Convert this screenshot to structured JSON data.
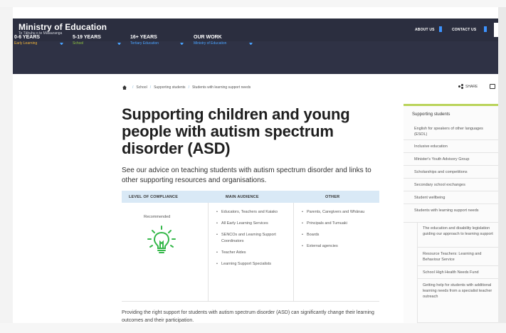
{
  "header": {
    "title": "Ministry of Education",
    "subtitle": "Te Tāhuhu o te Mātauranga",
    "utility_links": [
      {
        "label": "ABOUT US"
      },
      {
        "label": "CONTACT US"
      }
    ],
    "nav": [
      {
        "title": "0-6 YEARS",
        "sub": "Early Learning",
        "sub_color": "#f2b53a"
      },
      {
        "title": "5-19 YEARS",
        "sub": "School",
        "sub_color": "#8fc43f"
      },
      {
        "title": "16+ YEARS",
        "sub": "Tertiary Education",
        "sub_color": "#4aa3ff"
      },
      {
        "title": "OUR WORK",
        "sub": "Ministry of Education",
        "sub_color": "#4aa3ff"
      }
    ]
  },
  "breadcrumb": {
    "items": [
      "School",
      "Supporting students",
      "Students with learning support needs"
    ]
  },
  "share": {
    "label": "SHARE"
  },
  "main": {
    "headline": "Supporting children and young people with autism spectrum disorder (ASD)",
    "intro": "See our advice on teaching students with autism spectrum disorder and links to other supporting resources and organisations.",
    "table": {
      "headers": [
        "LEVEL OF COMPLIANCE",
        "MAIN AUDIENCE",
        "OTHER"
      ],
      "compliance": "Recommended",
      "main_audience": [
        "Educators, Teachers and Kaiako",
        "All Early Learning Services",
        "SENCOs and Learning Support Coordinators",
        "Teacher Aides",
        "Learning Support Specialists"
      ],
      "other": [
        "Parents, Caregivers and Whānau",
        "Principals and Tumuaki",
        "Boards",
        "External agencies"
      ]
    },
    "paragraph": "Providing the right support for students with autism spectrum disorder (ASD) can significantly change their learning outcomes and their participation."
  },
  "sidebar": {
    "title": "Supporting students",
    "items": [
      "English for speakers of other languages (ESOL)",
      "Inclusive education",
      "Minister's Youth Advisory Group",
      "Scholarships and competitions",
      "Secondary school exchanges",
      "Student wellbeing",
      "Students with learning support needs"
    ],
    "subitems": [
      "The education and disability legislation guiding our approach to learning support",
      "Resource Teachers: Learning and Behaviour Service",
      "School High Health Needs Fund",
      "Getting help for students with additional learning needs from a specialist teacher outreach"
    ]
  },
  "colors": {
    "header_bg": "#2a2d3e",
    "accent_blue": "#3d93ff",
    "table_header": "#d9e9f6",
    "sidebar_accent": "#b9d35a",
    "bulb_green": "#35b84a"
  }
}
